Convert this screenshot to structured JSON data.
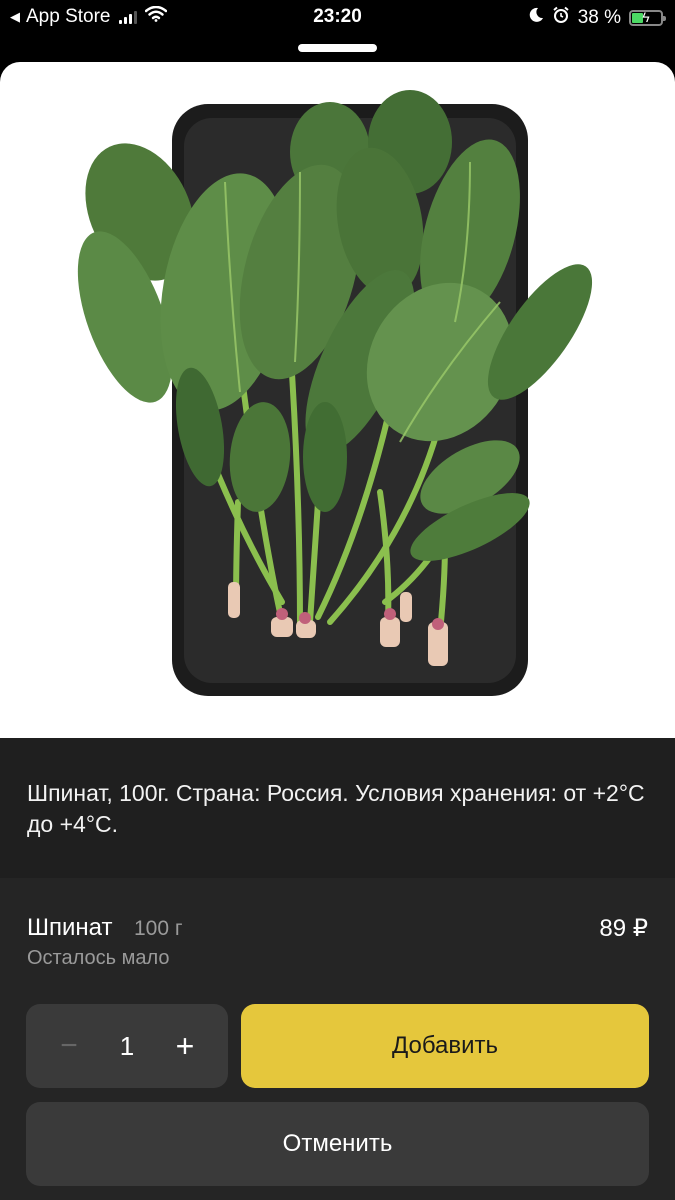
{
  "status_bar": {
    "back_app": "App Store",
    "time": "23:20",
    "battery_text": "38 %",
    "battery_level": 0.38,
    "icons": [
      "back-arrow-icon",
      "cellular-signal-icon",
      "wifi-icon",
      "moon-icon",
      "alarm-icon",
      "battery-charging-icon"
    ]
  },
  "product": {
    "image": "spinach-on-black-tray",
    "description": "Шпинат, 100г. Страна: Россия. Условия хранения: от +2°C до +4°C.",
    "name": "Шпинат",
    "weight": "100 г",
    "price": "89 ₽",
    "stock_status": "Осталось мало"
  },
  "stepper": {
    "minus": "−",
    "value": "1",
    "plus": "+"
  },
  "actions": {
    "add_label": "Добавить",
    "cancel_label": "Отменить"
  },
  "colors": {
    "add_button": "#e5c73c",
    "surface": "#252525",
    "battery_fill": "#4cd964"
  }
}
